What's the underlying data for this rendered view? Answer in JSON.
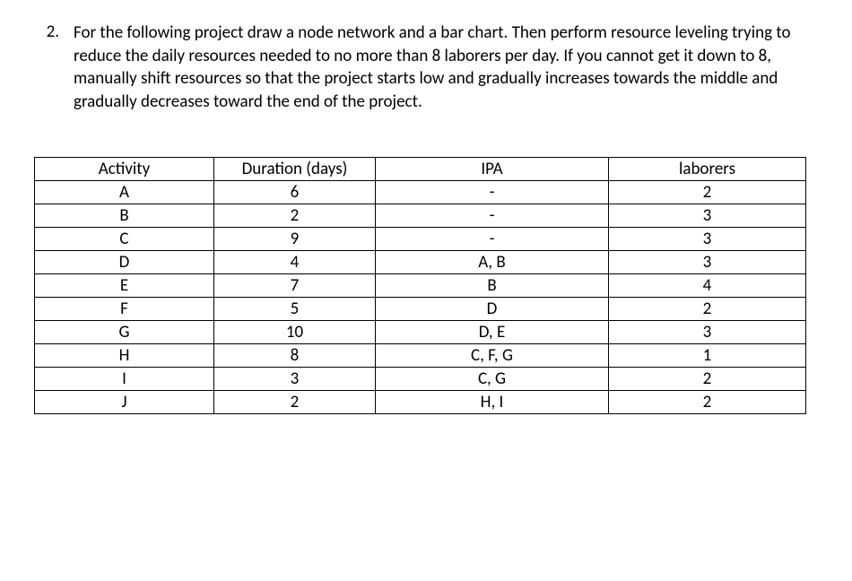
{
  "question": {
    "number": "2.",
    "text": "For the following project draw a node network and a bar chart.  Then perform resource leveling trying to reduce the daily resources needed to no more than 8 laborers per day.  If you cannot get it down to 8, manually shift resources so that the project starts low and gradually increases towards the middle and gradually decreases toward the end of the project."
  },
  "table": {
    "headers": {
      "activity": "Activity",
      "duration": "Duration (days)",
      "ipa": "IPA",
      "laborers": "laborers"
    },
    "rows": [
      {
        "activity": "A",
        "duration": "6",
        "ipa": "-",
        "laborers": "2"
      },
      {
        "activity": "B",
        "duration": "2",
        "ipa": "-",
        "laborers": "3"
      },
      {
        "activity": "C",
        "duration": "9",
        "ipa": "-",
        "laborers": "3"
      },
      {
        "activity": "D",
        "duration": "4",
        "ipa": "A, B",
        "laborers": "3"
      },
      {
        "activity": "E",
        "duration": "7",
        "ipa": "B",
        "laborers": "4"
      },
      {
        "activity": "F",
        "duration": "5",
        "ipa": "D",
        "laborers": "2"
      },
      {
        "activity": "G",
        "duration": "10",
        "ipa": "D, E",
        "laborers": "3"
      },
      {
        "activity": "H",
        "duration": "8",
        "ipa": "C, F, G",
        "laborers": "1"
      },
      {
        "activity": "I",
        "duration": "3",
        "ipa": "C, G",
        "laborers": "2"
      },
      {
        "activity": "J",
        "duration": "2",
        "ipa": "H, I",
        "laborers": "2"
      }
    ]
  },
  "chart_data": {
    "type": "table",
    "columns": [
      "Activity",
      "Duration (days)",
      "IPA",
      "laborers"
    ],
    "rows": [
      [
        "A",
        6,
        "-",
        2
      ],
      [
        "B",
        2,
        "-",
        3
      ],
      [
        "C",
        9,
        "-",
        3
      ],
      [
        "D",
        4,
        "A, B",
        3
      ],
      [
        "E",
        7,
        "B",
        4
      ],
      [
        "F",
        5,
        "D",
        2
      ],
      [
        "G",
        10,
        "D, E",
        3
      ],
      [
        "H",
        8,
        "C, F, G",
        1
      ],
      [
        "I",
        3,
        "C, G",
        2
      ],
      [
        "J",
        2,
        "H, I",
        2
      ]
    ]
  }
}
